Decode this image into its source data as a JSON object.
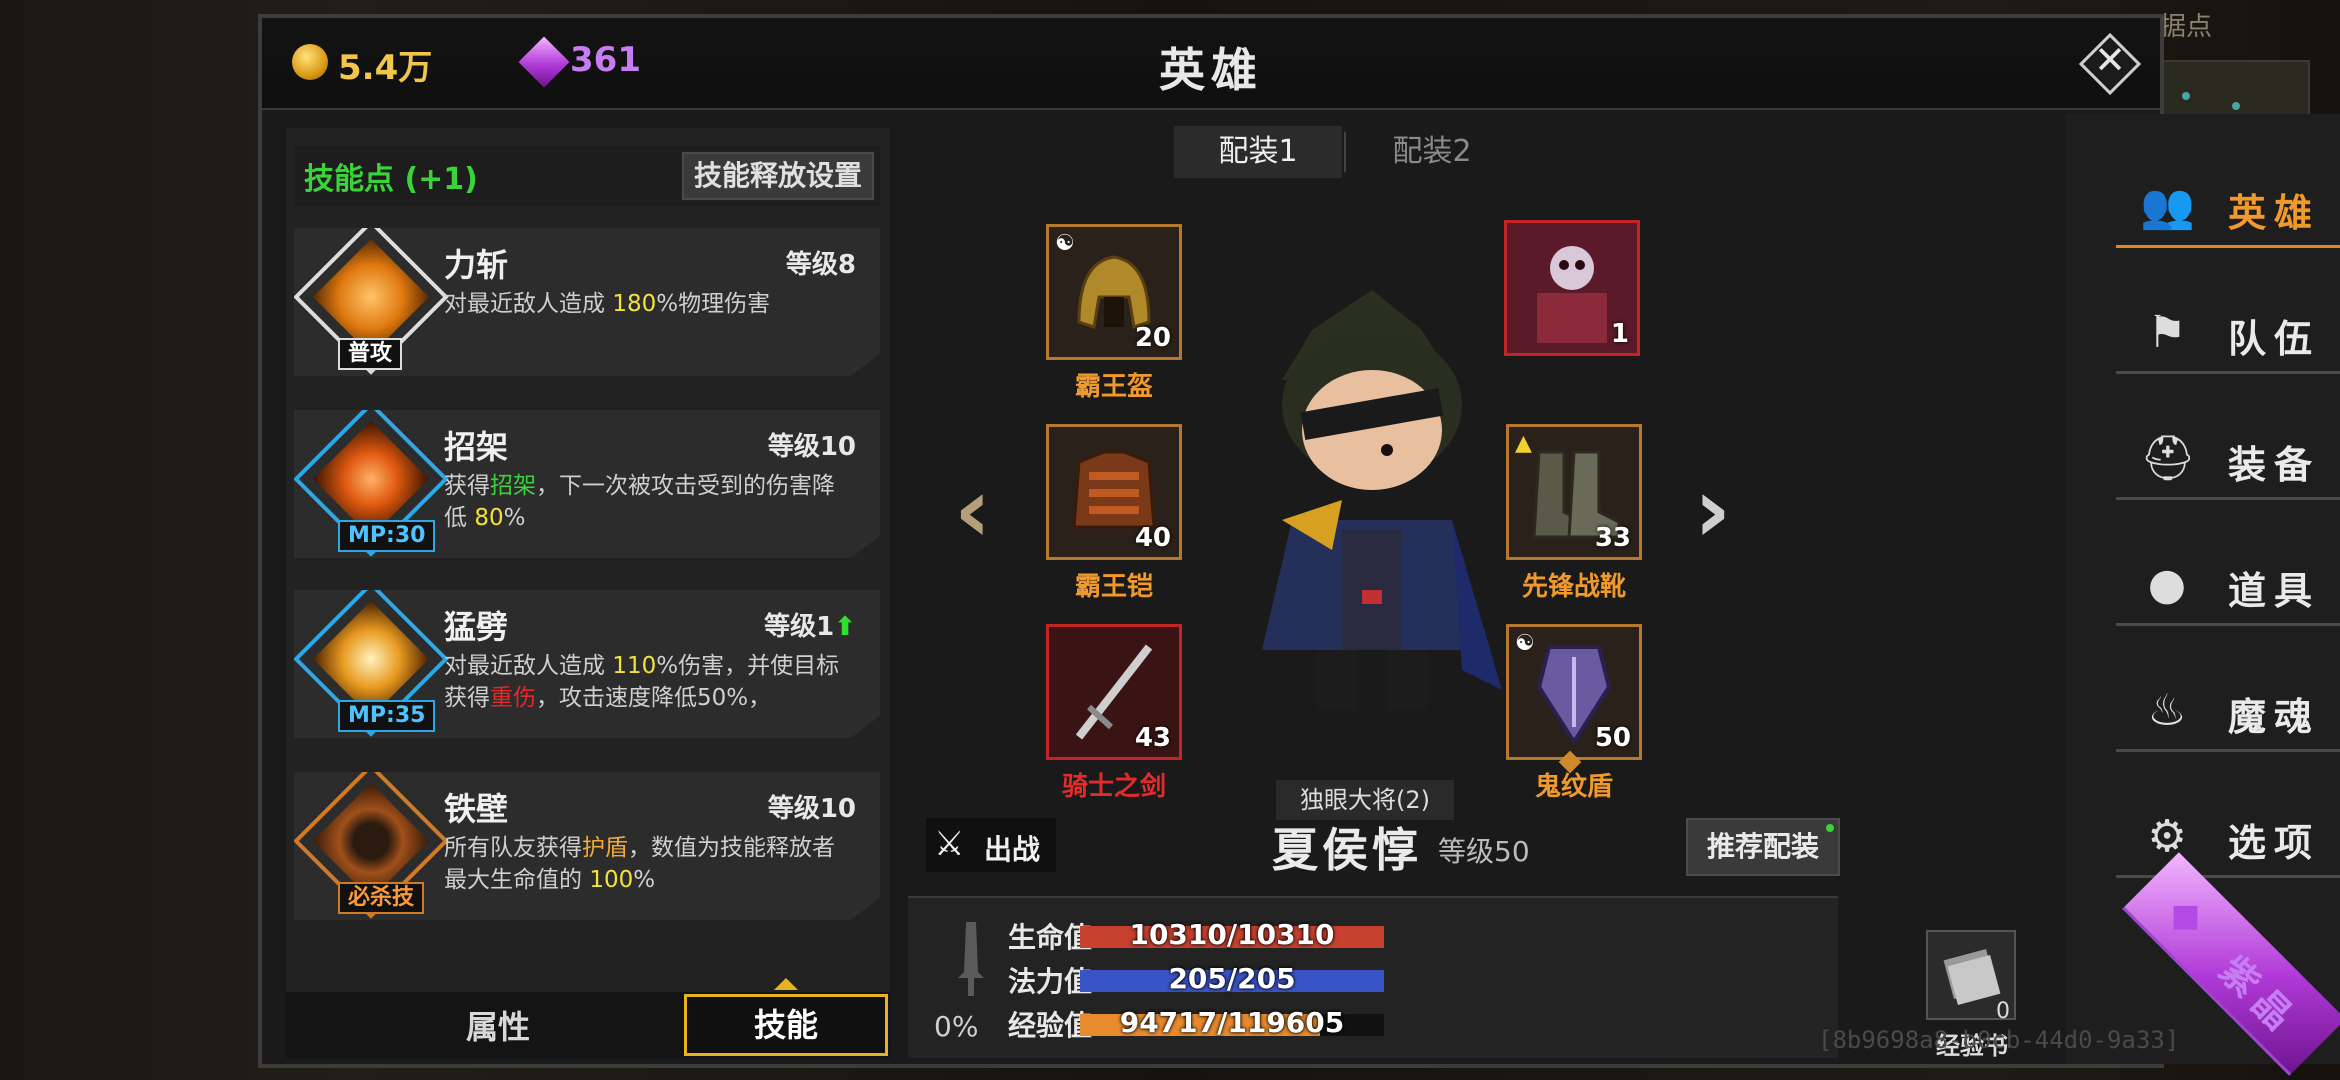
{
  "currency": {
    "gold": "5.4万",
    "gems": "361"
  },
  "window_title": "英雄",
  "background": {
    "map_label": "据点"
  },
  "skills_panel": {
    "points_label": "技能点 (+1)",
    "release_settings": "技能释放设置",
    "skills": [
      {
        "name": "力斩",
        "level": "等级8",
        "tag": "普攻",
        "desc": [
          {
            "t": "对最近敌人造成 "
          },
          {
            "t": "180",
            "c": "y"
          },
          {
            "t": "%物理伤害"
          }
        ]
      },
      {
        "name": "招架",
        "level": "等级10",
        "tag": "MP:30",
        "desc": [
          {
            "t": "获得"
          },
          {
            "t": "招架",
            "c": "g"
          },
          {
            "t": "，下一次被攻击受到的伤害降低 "
          },
          {
            "t": "80",
            "c": "y"
          },
          {
            "t": "%"
          }
        ]
      },
      {
        "name": "猛劈",
        "level": "等级1",
        "level_up": true,
        "tag": "MP:35",
        "desc": [
          {
            "t": "对最近敌人造成 "
          },
          {
            "t": "110",
            "c": "y"
          },
          {
            "t": "%伤害，并使目标获得"
          },
          {
            "t": "重伤",
            "c": "r"
          },
          {
            "t": "，攻击速度降低50%，"
          }
        ]
      },
      {
        "name": "铁壁",
        "level": "等级10",
        "tag": "必杀技",
        "desc": [
          {
            "t": "所有队友获得"
          },
          {
            "t": "护盾",
            "c": "o"
          },
          {
            "t": "，数值为技能释放者最大生命值的 "
          },
          {
            "t": "100",
            "c": "y"
          },
          {
            "t": "%"
          }
        ]
      }
    ],
    "tabs": {
      "attributes": "属性",
      "skills": "技能"
    }
  },
  "loadout_tabs": [
    "配装1",
    "配装2"
  ],
  "equipment": {
    "helmet": {
      "name": "霸王盔",
      "count": "20"
    },
    "armor": {
      "name": "霸王铠",
      "count": "40"
    },
    "weapon": {
      "name": "骑士之剑",
      "count": "43"
    },
    "companion": {
      "count": "1"
    },
    "boots": {
      "name": "先锋战靴",
      "count": "33"
    },
    "shield": {
      "name": "鬼纹盾",
      "count": "50"
    }
  },
  "hero": {
    "title_badge": "独眼大将(2)",
    "name": "夏侯惇",
    "level": "等级50"
  },
  "deploy_label": "出战",
  "recommend_label": "推荐配装",
  "stats": {
    "weight_pct": "0%",
    "hp": {
      "label": "生命值",
      "text": "10310/10310",
      "ratio": 1.0,
      "color": "#c8402e"
    },
    "mp": {
      "label": "法力值",
      "text": "205/205",
      "ratio": 1.0,
      "color": "#3a54c8"
    },
    "xp": {
      "label": "经验值",
      "text": "94717/119605",
      "ratio": 0.79,
      "color": "#e88a2e"
    },
    "xp_book": {
      "label": "经验书",
      "count": "0"
    }
  },
  "nav": [
    {
      "id": "hero",
      "label": "英雄",
      "icon": "hero-icon"
    },
    {
      "id": "team",
      "label": "队伍",
      "icon": "flag-icon"
    },
    {
      "id": "equipment",
      "label": "装备",
      "icon": "helmet-icon"
    },
    {
      "id": "items",
      "label": "道具",
      "icon": "bag-icon"
    },
    {
      "id": "soul",
      "label": "魔魂",
      "icon": "flame-icon"
    },
    {
      "id": "options",
      "label": "选项",
      "icon": "gear-icon"
    },
    {
      "id": "gems",
      "label": "紫晶",
      "icon": "gem-icon"
    }
  ],
  "uid": "[8b9698a8-b0cb-44d0-9a33]"
}
